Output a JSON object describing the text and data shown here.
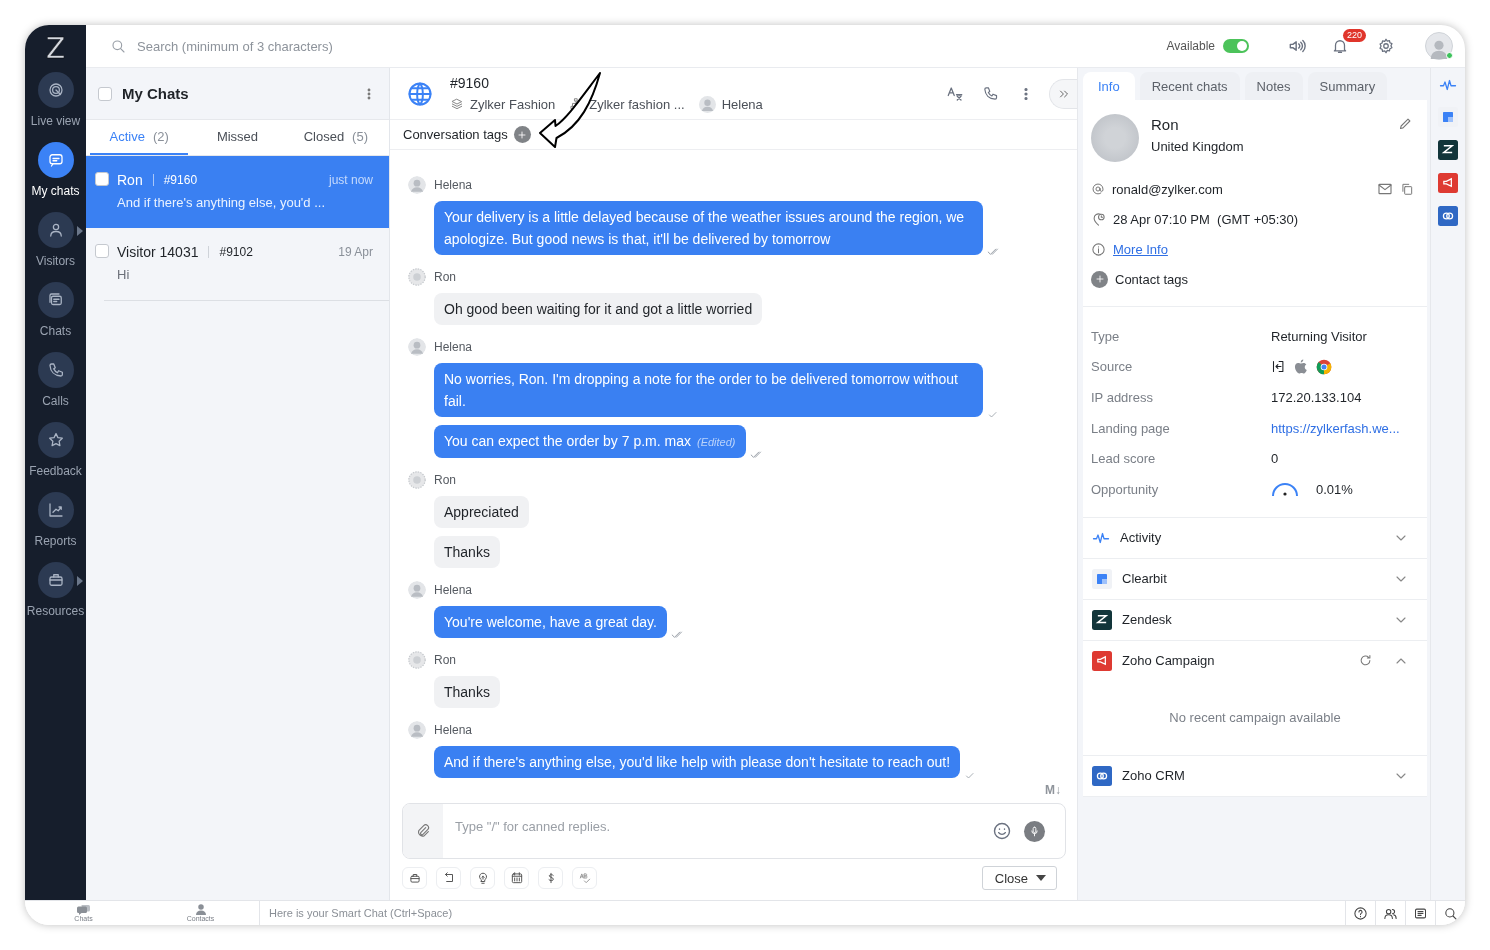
{
  "rail": {
    "logo": "Z",
    "items": [
      {
        "kind": "live",
        "label": "Live view",
        "selected": false,
        "submenu": false
      },
      {
        "kind": "mychats",
        "label": "My chats",
        "selected": true,
        "submenu": false
      },
      {
        "kind": "visitors",
        "label": "Visitors",
        "selected": false,
        "submenu": true
      },
      {
        "kind": "chats",
        "label": "Chats",
        "selected": false,
        "submenu": false
      },
      {
        "kind": "calls",
        "label": "Calls",
        "selected": false,
        "submenu": false
      },
      {
        "kind": "feedback",
        "label": "Feedback",
        "selected": false,
        "submenu": false
      },
      {
        "kind": "reports",
        "label": "Reports",
        "selected": false,
        "submenu": false
      },
      {
        "kind": "resources",
        "label": "Resources",
        "selected": false,
        "submenu": true
      }
    ]
  },
  "topbar": {
    "search_placeholder": "Search (minimum of 3 characters)",
    "status": {
      "label": "Available",
      "on": true
    },
    "notification_count": "220"
  },
  "chat_list": {
    "title": "My Chats",
    "select_all_checked": false,
    "tabs": [
      {
        "label": "Active",
        "count": "(2)",
        "selected": true
      },
      {
        "label": "Missed",
        "selected": false
      },
      {
        "label": "Closed",
        "count": "(5)",
        "selected": false
      }
    ],
    "chats": [
      {
        "name": "Ron",
        "id": "#9160",
        "time": "just now",
        "preview": "And if there's anything else, you'd ...",
        "selected": true,
        "checked": false
      },
      {
        "name": "Visitor 14031",
        "id": "#9102",
        "time": "19 Apr",
        "preview": "Hi",
        "selected": false,
        "checked": false
      }
    ]
  },
  "conversation": {
    "id": "#9160",
    "meta": [
      {
        "kind": "brand",
        "text": "Zylker Fashion"
      },
      {
        "kind": "department",
        "text": "Zylker fashion ..."
      },
      {
        "kind": "agent",
        "text": "Helena"
      }
    ],
    "tags_label": "Conversation tags",
    "messages": [
      {
        "sender": "Helena",
        "kind": "agent",
        "bubbles": [
          {
            "text": "Your delivery is a little delayed because of the weather issues around the region, we apologize. But good news is that, it'll be delivered by tomorrow",
            "read": true
          }
        ]
      },
      {
        "sender": "Ron",
        "kind": "visitor",
        "bubbles": [
          {
            "text": "Oh good been waiting for it and got a little worried"
          }
        ]
      },
      {
        "sender": "Helena",
        "kind": "agent",
        "bubbles": [
          {
            "text": "No worries, Ron. I'm dropping a note for the order to be delivered tomorrow without fail.",
            "read": false
          },
          {
            "text": "You can expect the order by 7 p.m. max",
            "edited": "(Edited)",
            "read": true
          }
        ]
      },
      {
        "sender": "Ron",
        "kind": "visitor",
        "bubbles": [
          {
            "text": "Appreciated"
          },
          {
            "text": "Thanks"
          }
        ]
      },
      {
        "sender": "Helena",
        "kind": "agent",
        "bubbles": [
          {
            "text": "You're welcome, have a great day.",
            "read": true
          }
        ]
      },
      {
        "sender": "Ron",
        "kind": "visitor",
        "bubbles": [
          {
            "text": "Thanks"
          }
        ]
      },
      {
        "sender": "Helena",
        "kind": "agent",
        "bubbles": [
          {
            "text": "And if there's anything else, you'd like help with please don't hesitate to reach out!",
            "read": false
          }
        ]
      }
    ],
    "markdown_label": "M↓",
    "composer_placeholder": "Type \"/\" for canned replies.",
    "close_label": "Close"
  },
  "details": {
    "tabs": [
      {
        "label": "Info",
        "selected": true
      },
      {
        "label": "Recent chats",
        "selected": false
      },
      {
        "label": "Notes",
        "selected": false
      },
      {
        "label": "Summary",
        "selected": false
      }
    ],
    "name": "Ron",
    "country": "United Kingdom",
    "email": "ronald@zylker.com",
    "local_time": "28 Apr 07:10 PM  (GMT +05:30)",
    "more_info": "More Info",
    "contact_tags": "Contact tags",
    "fields": [
      {
        "kind": "text",
        "label": "Type",
        "value": "Returning Visitor"
      },
      {
        "kind": "source",
        "label": "Source"
      },
      {
        "kind": "text",
        "label": "IP address",
        "value": "172.20.133.104"
      },
      {
        "kind": "link",
        "label": "Landing page",
        "value": "https://zylkerfash.we..."
      },
      {
        "kind": "text",
        "label": "Lead score",
        "value": "0"
      },
      {
        "kind": "gauge",
        "label": "Opportunity",
        "value": "0.01%"
      }
    ],
    "integrations": [
      {
        "kind": "activity",
        "label": "Activity",
        "expanded": false
      },
      {
        "kind": "clearbit",
        "label": "Clearbit",
        "expanded": false
      },
      {
        "kind": "zendesk",
        "label": "Zendesk",
        "expanded": false
      },
      {
        "kind": "campaign",
        "label": "Zoho Campaign",
        "expanded": true,
        "empty_text": "No recent campaign available"
      },
      {
        "kind": "crm",
        "label": "Zoho CRM",
        "expanded": false
      }
    ]
  },
  "bottom_bar": {
    "tabs": [
      {
        "kind": "chats",
        "label": "Chats"
      },
      {
        "kind": "contacts",
        "label": "Contacts"
      }
    ],
    "hint": "Here is your Smart Chat (Ctrl+Space)"
  }
}
